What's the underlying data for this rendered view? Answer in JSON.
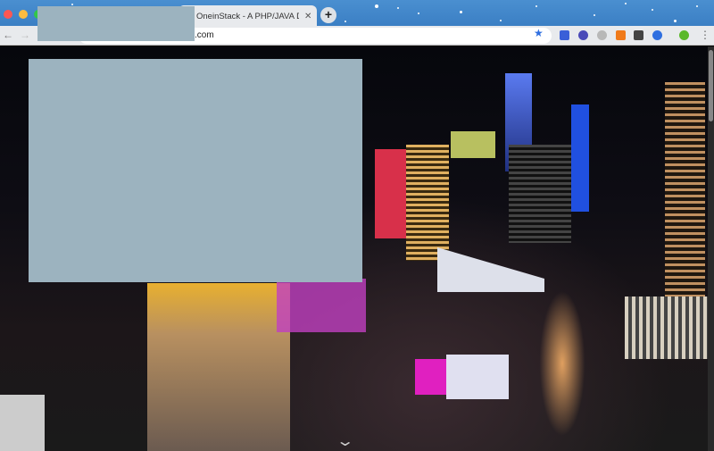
{
  "tab": {
    "title": "OneinStack - A PHP/JAVA Dep",
    "close": "✕"
  },
  "new_tab": "+",
  "address": {
    "url_suffix": ".com"
  },
  "nav": {
    "back": "←",
    "forward": "→"
  },
  "bookmark_star": "★",
  "menu": "⋮",
  "scroll_hint": "⌄",
  "extensions": [
    {
      "name": "jh-extension-icon",
      "color": "#3a5fd8"
    },
    {
      "name": "globe-extension-icon",
      "color": "#4a4ab8"
    },
    {
      "name": "gear-extension-icon",
      "color": "#b8b8b8"
    },
    {
      "name": "orange-extension-icon",
      "color": "#f07a1a"
    },
    {
      "name": "qr-code-extension-icon",
      "color": "#444444"
    },
    {
      "name": "lifebuoy-extension-icon",
      "color": "#2f6fe0"
    },
    {
      "name": "profile-extension-icon",
      "color": "#5ab82a"
    }
  ]
}
